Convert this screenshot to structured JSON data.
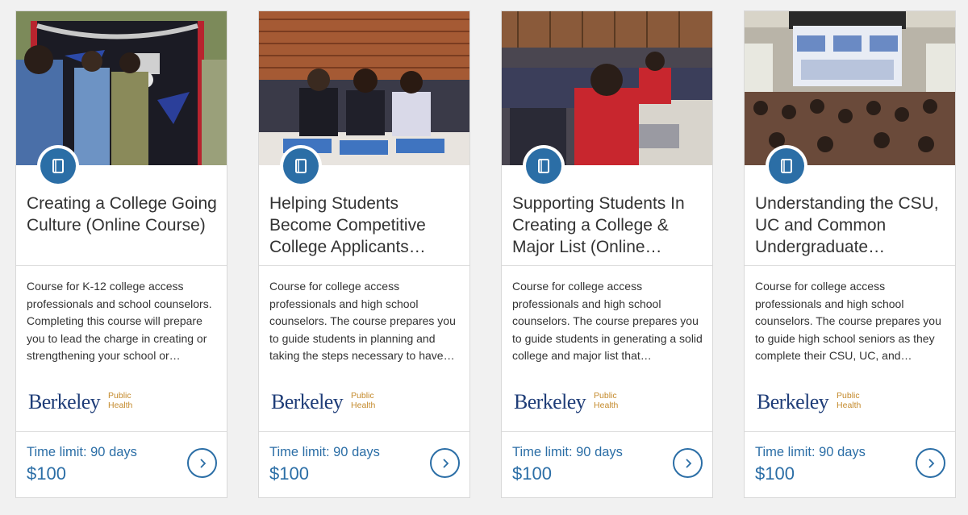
{
  "colors": {
    "accent": "#2b6ea6",
    "provider_text": "#1f3d78",
    "provider_subtext": "#c48a2c",
    "page_background": "#f1f1f1"
  },
  "cards": [
    {
      "title": "Creating a College Going Culture (Online Course)",
      "description": "Course for K-12 college access professionals and school counselors. Completing this course will prepare you to lead the charge in creating or strengthening your school or…",
      "provider_name": "Berkeley",
      "provider_sub1": "Public",
      "provider_sub2": "Health",
      "time_limit": "Time limit: 90 days",
      "price": "$100",
      "icon": "book-icon",
      "action_icon": "chevron-right-icon"
    },
    {
      "title": "Helping Students Become Competitive College Applicants…",
      "description": "Course for college access professionals and high school counselors. The course prepares you to guide students in planning and taking the steps necessary to have…",
      "provider_name": "Berkeley",
      "provider_sub1": "Public",
      "provider_sub2": "Health",
      "time_limit": "Time limit: 90 days",
      "price": "$100",
      "icon": "book-icon",
      "action_icon": "chevron-right-icon"
    },
    {
      "title": "Supporting Students In Creating a College & Major List (Online…",
      "description": "Course for college access professionals and high school counselors. The course prepares you to guide students in generating a solid college and major list that…",
      "provider_name": "Berkeley",
      "provider_sub1": "Public",
      "provider_sub2": "Health",
      "time_limit": "Time limit: 90 days",
      "price": "$100",
      "icon": "book-icon",
      "action_icon": "chevron-right-icon"
    },
    {
      "title": "Understanding the CSU, UC and Common Undergraduate…",
      "description": "Course for college access professionals and high school counselors. The course prepares you to guide high school seniors as they complete their CSU, UC, and…",
      "provider_name": "Berkeley",
      "provider_sub1": "Public",
      "provider_sub2": "Health",
      "time_limit": "Time limit: 90 days",
      "price": "$100",
      "icon": "book-icon",
      "action_icon": "chevron-right-icon"
    }
  ]
}
